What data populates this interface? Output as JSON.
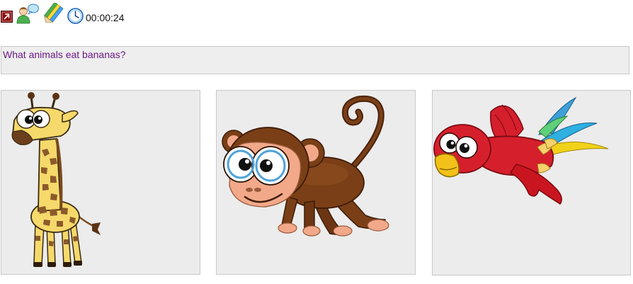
{
  "toolbar": {
    "icons": [
      "exit-icon",
      "chat-users-icon",
      "pencils-icon",
      "clock-icon"
    ],
    "timer": "00:00:24"
  },
  "question": {
    "text": "What animals eat bananas?"
  },
  "answers": [
    {
      "animal": "giraffe"
    },
    {
      "animal": "monkey"
    },
    {
      "animal": "parrot"
    }
  ],
  "colors": {
    "question_text": "#6b1a87",
    "card_background": "#ececec",
    "card_border": "#c9c9c9"
  }
}
